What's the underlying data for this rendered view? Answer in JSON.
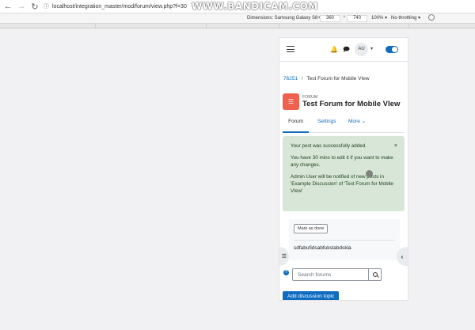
{
  "browser": {
    "url": "localhost/integration_master/mod/forum/view.php?f=30",
    "watermark": "WWW.BANDICAM.COM"
  },
  "devtools": {
    "dimensions_label": "Dimensions: Samsung Galaxy S8+ ▾",
    "width": "360",
    "height": "740",
    "times": "×",
    "zoom": "100% ▾",
    "throttling": "No throttling ▾"
  },
  "header": {
    "avatar_initials": "AU"
  },
  "breadcrumb": {
    "course": "76251",
    "separator": "/",
    "current": "Test Forum for Mobile VIew"
  },
  "activity": {
    "kind": "FORUM",
    "title": "Test Forum for Mobile VIew"
  },
  "tabs": [
    {
      "label": "Forum"
    },
    {
      "label": "Settings"
    },
    {
      "label": "More"
    }
  ],
  "alert": {
    "line1": "Your post was successfully added.",
    "line2": "You have 30 mins to edit it if you want to make any changes.",
    "line3": "Admin User will be notified of new posts in 'Example Discussion' of 'Test Forum for Mobile VIew'",
    "close": "×"
  },
  "discussion": {
    "mark_done_label": "Mark as done",
    "title": "sdfabufidsabfukslabdskla"
  },
  "search": {
    "placeholder": "Search forums"
  },
  "actions": {
    "add_discussion": "Add discussion topic"
  },
  "colors": {
    "primary": "#0f6cbf",
    "forum_icon": "#f0604e",
    "success_bg": "#d7e6d7"
  }
}
